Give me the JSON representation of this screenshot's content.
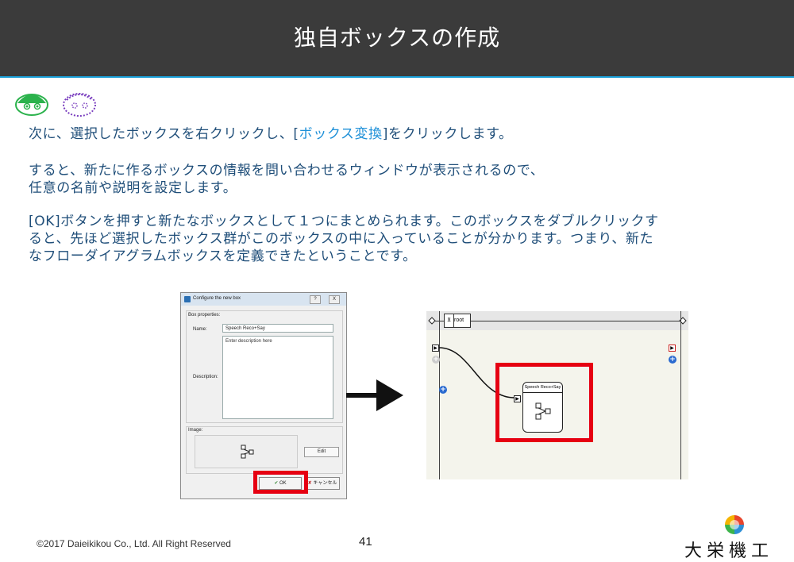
{
  "slide": {
    "title": "独自ボックスの作成",
    "para1_pre": "次に、選択したボックスを右クリックし、[",
    "para1_link": "ボックス変換",
    "para1_post": "]をクリックします。",
    "para2_line1": "すると、新たに作るボックスの情報を問い合わせるウィンドウが表示されるので、",
    "para2_line2": "任意の名前や説明を設定します。",
    "para3_line1": "[OK]ボタンを押すと新たなボックスとして１つにまとめられます。このボックスをダブルクリックす",
    "para3_line2": "ると、先ほど選択したボックス群がこのボックスの中に入っていることが分かります。つまり、新た",
    "para3_line3": "なフローダイアグラムボックスを定義できたということです。",
    "link_color": "#1e90d8"
  },
  "dialog": {
    "title": "Configure the new box",
    "help_label": "?",
    "close_label": "X",
    "box_properties_label": "Box properties:",
    "name_label": "Name:",
    "name_value": "Speech Reco+Say",
    "description_label": "Description:",
    "description_placeholder": "Enter description here",
    "image_label": "Image:",
    "edit_label": "Edit",
    "ok_label": "OK",
    "cancel_label": "キャンセル"
  },
  "flow_editor": {
    "root_label": "root",
    "node_label": "Speech Reco+Say"
  },
  "highlight_color": "#e60012",
  "footer": {
    "copyright": "©2017 Daieikikou Co., Ltd. All Right Reserved",
    "page_number": "41",
    "company_name": "大栄機工"
  }
}
